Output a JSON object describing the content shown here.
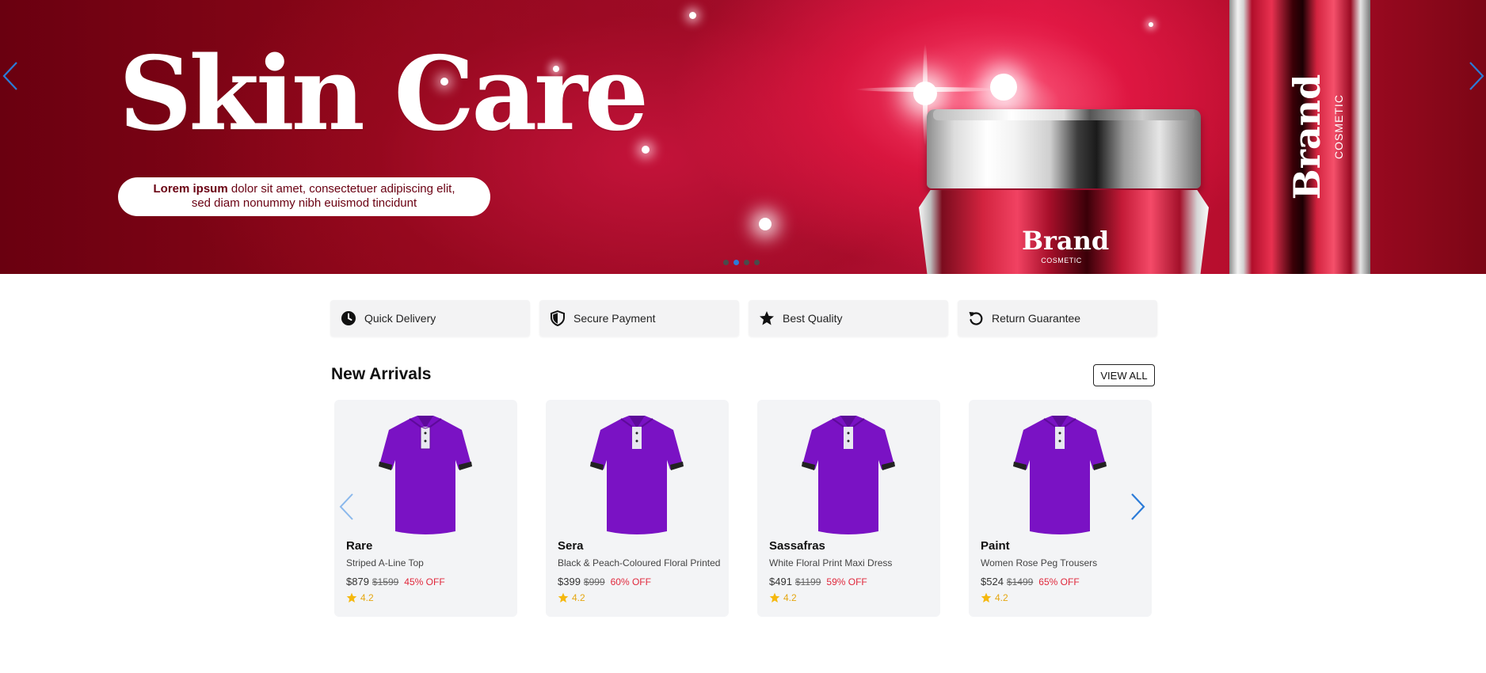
{
  "hero": {
    "title": "Skin Care",
    "tagline_bold": "Lorem ipsum",
    "tagline_rest": " dolor sit amet, consectetuer adipiscing elit,",
    "tagline_line2": "sed diam nonummy nibh euismod tincidunt",
    "product_brand": "Brand",
    "product_sub": "COSMETIC",
    "tube_brand": "Brand",
    "tube_sub": "COSMETIC",
    "slide_count": 4,
    "active_slide": 2,
    "colors": {
      "arrow": "#2b7bd8",
      "dot_active": "#2b7bd8",
      "dot": "#4a4a4a"
    }
  },
  "features": [
    {
      "label": "Quick Delivery",
      "icon": "clock-icon"
    },
    {
      "label": "Secure Payment",
      "icon": "shield-icon"
    },
    {
      "label": "Best Quality",
      "icon": "star-icon"
    },
    {
      "label": "Return Guarantee",
      "icon": "undo-icon"
    }
  ],
  "arrivals": {
    "title": "New Arrivals",
    "view_all": "VIEW ALL",
    "products": [
      {
        "name": "Rare",
        "desc": "Striped A-Line Top",
        "price": "$879",
        "old_price": "$1599",
        "discount": "45% OFF",
        "rating": "4.2"
      },
      {
        "name": "Sera",
        "desc": "Black & Peach-Coloured Floral Printed",
        "price": "$399",
        "old_price": "$999",
        "discount": "60% OFF",
        "rating": "4.2"
      },
      {
        "name": "Sassafras",
        "desc": "White Floral Print Maxi Dress",
        "price": "$491",
        "old_price": "$1199",
        "discount": "59% OFF",
        "rating": "4.2"
      },
      {
        "name": "Paint",
        "desc": "Women Rose Peg Trousers",
        "price": "$524",
        "old_price": "$1499",
        "discount": "65% OFF",
        "rating": "4.2"
      }
    ],
    "colors": {
      "shirt": "#7a12c4",
      "discount": "#e0283c",
      "star": "#f5b80e"
    }
  }
}
